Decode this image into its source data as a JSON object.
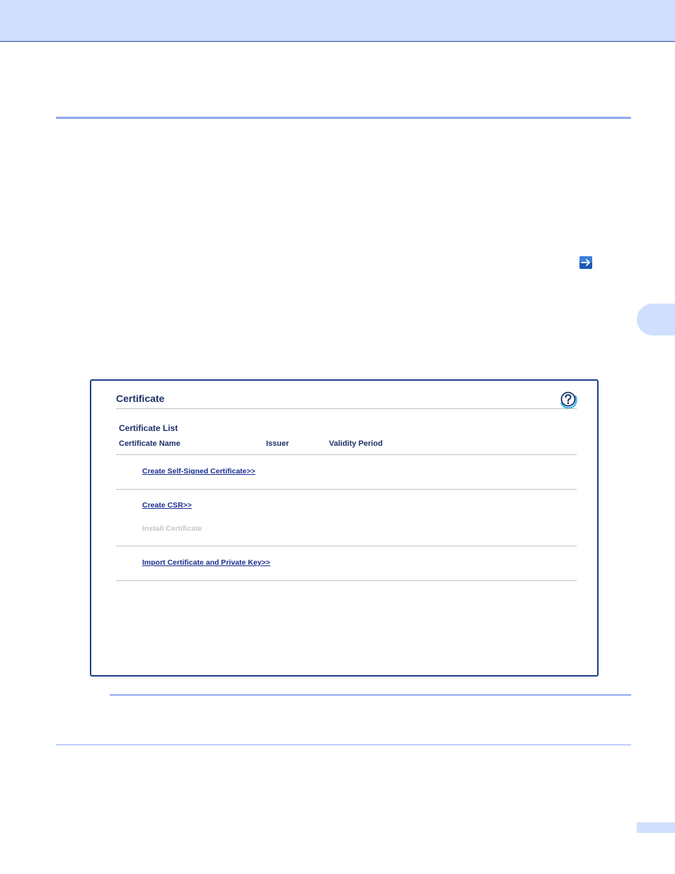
{
  "certificate_panel": {
    "title": "Certificate",
    "help_icon": "question-mark-circle-icon",
    "list_heading": "Certificate List",
    "columns": [
      "Certificate Name",
      "Issuer",
      "Validity Period"
    ],
    "links": {
      "create_self_signed": "Create Self-Signed Certificate>>",
      "create_csr": "Create CSR>>",
      "install_certificate": "Install Certificate",
      "import_certificate": "Import Certificate and Private Key>>"
    }
  },
  "icons": {
    "reference_arrow": "right-arrow-icon"
  },
  "colors": {
    "header_band": "#cfdffd",
    "accent_rule": "#8fa9ef",
    "panel_border": "#1b3f8c",
    "link": "#1a2e8f",
    "heading_text": "#1d3167",
    "disabled_text": "#c6c6c6"
  }
}
